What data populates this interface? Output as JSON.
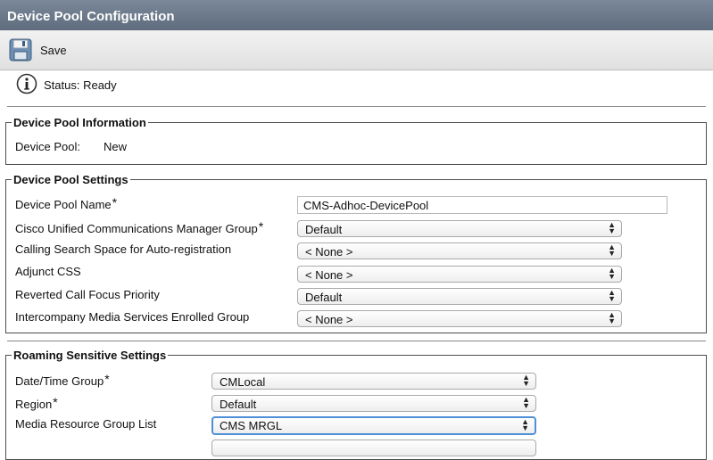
{
  "window": {
    "title": "Device Pool Configuration"
  },
  "toolbar": {
    "save_label": "Save"
  },
  "status": {
    "text": "Status: Ready"
  },
  "device_pool_information": {
    "legend": "Device Pool Information",
    "label": "Device Pool:",
    "value": "New"
  },
  "device_pool_settings": {
    "legend": "Device Pool Settings",
    "name_label": "Device Pool Name",
    "name_value": "CMS-Adhoc-DevicePool",
    "rows": [
      {
        "label": "Cisco Unified Communications Manager Group",
        "required": "*",
        "value": "Default"
      },
      {
        "label": "Calling Search Space for Auto-registration",
        "required": "",
        "value": "< None >"
      },
      {
        "label": "Adjunct CSS",
        "required": "",
        "value": "< None >"
      },
      {
        "label": "Reverted Call Focus Priority",
        "required": "",
        "value": "Default"
      },
      {
        "label": "Intercompany Media Services Enrolled Group",
        "required": "",
        "value": "< None >"
      }
    ],
    "required_mark": "*"
  },
  "roaming_sensitive_settings": {
    "legend": "Roaming Sensitive Settings",
    "rows": [
      {
        "label": "Date/Time Group",
        "required": "*",
        "value": "CMLocal"
      },
      {
        "label": "Region",
        "required": "*",
        "value": "Default"
      },
      {
        "label": "Media Resource Group List",
        "required": "",
        "value": "CMS MRGL"
      }
    ]
  },
  "icons": {
    "save": "floppy-disk-icon",
    "info": "info-icon",
    "dropdown": "updown-arrows-icon"
  }
}
